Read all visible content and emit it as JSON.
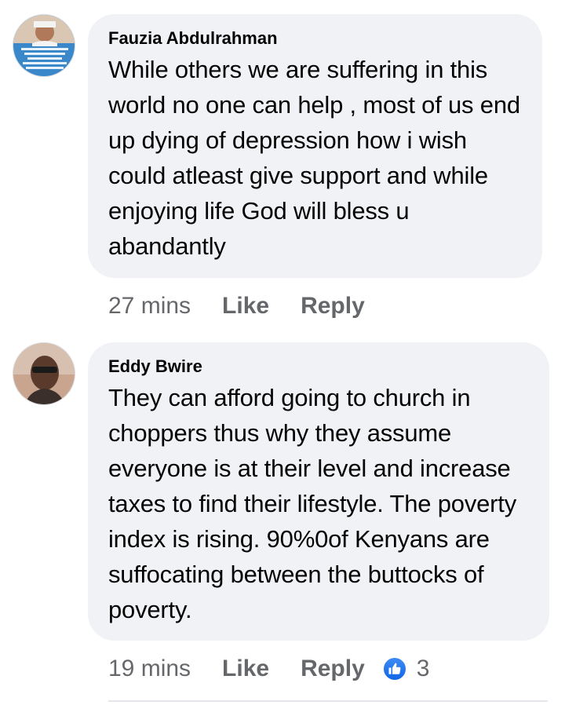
{
  "comments": [
    {
      "author": "Fauzia Abdulrahman",
      "text": "While others  we are suffering in this world  no one can help  , most of us end up dying of depression how i wish could  atleast give support and while enjoying life God will bless u abandantly",
      "time": "27 mins",
      "like_label": "Like",
      "reply_label": "Reply"
    },
    {
      "author": "Eddy Bwire",
      "text": "They can afford going to church in choppers thus why they assume everyone is at their level and increase taxes to find their lifestyle. The poverty index is rising. 90%0of Kenyans are suffocating between the buttocks of poverty.",
      "time": "19 mins",
      "like_label": "Like",
      "reply_label": "Reply",
      "reaction_icon": "like-thumb-icon",
      "reaction_count": "3"
    }
  ],
  "colors": {
    "bubble": "#f0f2f5",
    "meta_text": "#65676b",
    "like_blue": "#1877f2"
  }
}
